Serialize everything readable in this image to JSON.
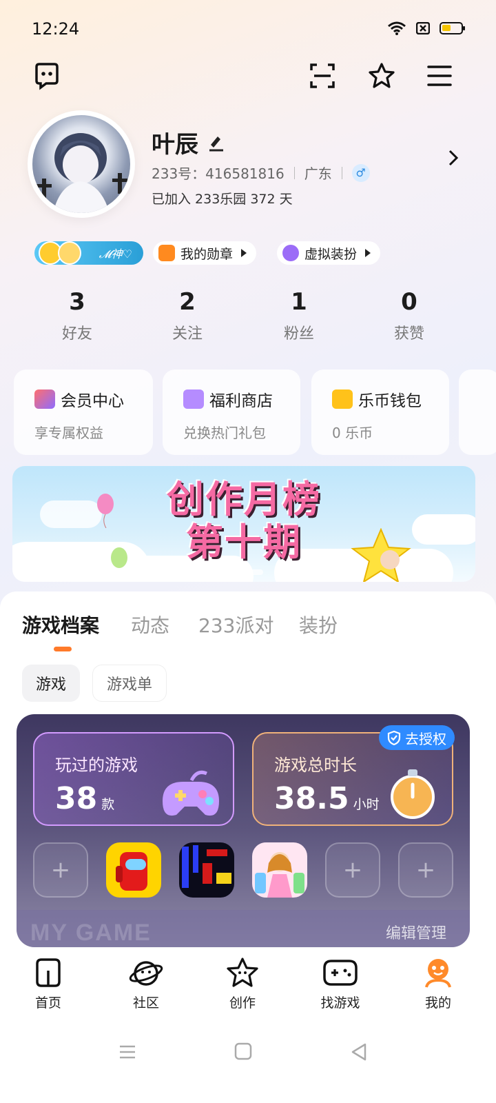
{
  "status": {
    "time": "12:24"
  },
  "profile": {
    "name": "叶辰",
    "id_label": "233号：416581816",
    "region": "广东",
    "gender_icon": "♂",
    "joined": "已加入 233乐园 372 天"
  },
  "chips": {
    "badge_text": "𝓜神♡",
    "medal_label": "我的勋章",
    "outfit_label": "虚拟装扮"
  },
  "stats": [
    {
      "value": "3",
      "label": "好友"
    },
    {
      "value": "2",
      "label": "关注"
    },
    {
      "value": "1",
      "label": "粉丝"
    },
    {
      "value": "0",
      "label": "获赞"
    }
  ],
  "features": [
    {
      "title": "会员中心",
      "subtitle": "享专属权益",
      "color": "#ff6e6e"
    },
    {
      "title": "福利商店",
      "subtitle": "兑换热门礼包",
      "color": "#b58cff"
    },
    {
      "title": "乐币钱包",
      "subtitle": "0 乐币",
      "color": "#ffc21a"
    }
  ],
  "banner": {
    "line1": "创作月榜",
    "line2": "第十期"
  },
  "tabs": [
    "游戏档案",
    "动态",
    "233派对",
    "装扮"
  ],
  "subtabs": [
    "游戏",
    "游戏单"
  ],
  "game_card": {
    "played_label": "玩过的游戏",
    "played_value": "38",
    "played_unit": "款",
    "time_label": "游戏总时长",
    "time_value": "38.5",
    "time_unit": "小时",
    "auth_label": "去授权",
    "watermark": "MY GAME",
    "edit_label": "编辑管理"
  },
  "nav": [
    {
      "label": "首页",
      "icon": "home-icon"
    },
    {
      "label": "社区",
      "icon": "community-icon"
    },
    {
      "label": "创作",
      "icon": "create-icon"
    },
    {
      "label": "找游戏",
      "icon": "gamepad-icon"
    },
    {
      "label": "我的",
      "icon": "profile-icon",
      "active": true
    }
  ],
  "colors": {
    "accent": "#ff7a2a",
    "auth_blue": "#2f8bff",
    "card_dark": "#3e3760"
  }
}
